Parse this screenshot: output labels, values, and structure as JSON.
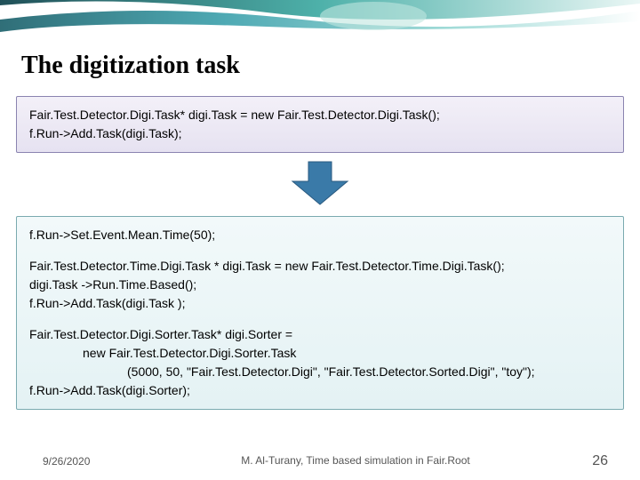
{
  "title": "The digitization task",
  "box1": {
    "line1": "Fair.Test.Detector.Digi.Task* digi.Task = new Fair.Test.Detector.Digi.Task();",
    "line2": "f.Run->Add.Task(digi.Task);"
  },
  "box2": {
    "p1l1": "f.Run->Set.Event.Mean.Time(50);",
    "p2l1": "Fair.Test.Detector.Time.Digi.Task * digi.Task = new Fair.Test.Detector.Time.Digi.Task();",
    "p2l2": "digi.Task ->Run.Time.Based();",
    "p2l3": "f.Run->Add.Task(digi.Task );",
    "p3l1": "Fair.Test.Detector.Digi.Sorter.Task* digi.Sorter =",
    "p3l2": "new Fair.Test.Detector.Digi.Sorter.Task",
    "p3l3": "(5000, 50, \"Fair.Test.Detector.Digi\", \"Fair.Test.Detector.Sorted.Digi\", \"toy\");",
    "p3l4": "f.Run->Add.Task(digi.Sorter);"
  },
  "footer": {
    "date": "9/26/2020",
    "center": "M. Al-Turany, Time based simulation in Fair.Root",
    "page": "26"
  },
  "colors": {
    "arrow": "#3a7aa8"
  }
}
